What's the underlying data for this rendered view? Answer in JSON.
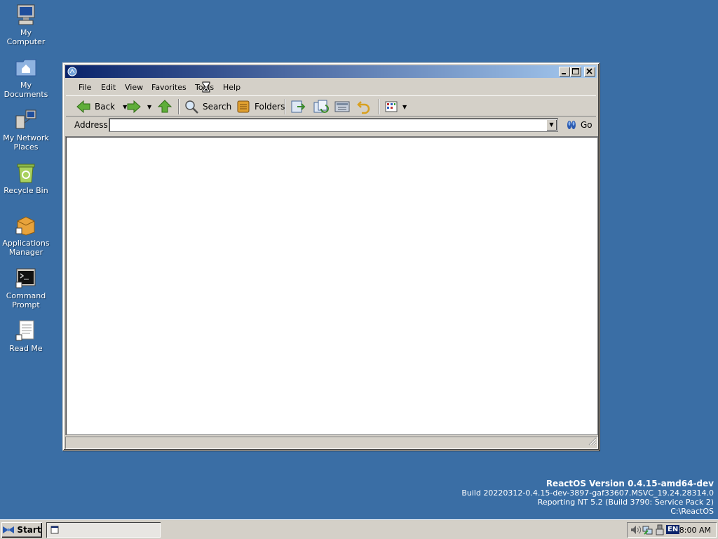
{
  "desktop": {
    "icons": [
      {
        "label": "My Computer"
      },
      {
        "label": "My Documents"
      },
      {
        "label": "My Network Places"
      },
      {
        "label": "Recycle Bin"
      },
      {
        "label": "Applications Manager"
      },
      {
        "label": "Command Prompt"
      },
      {
        "label": "Read Me"
      }
    ]
  },
  "window": {
    "title": "",
    "menu": [
      "File",
      "Edit",
      "View",
      "Favorites",
      "Tools",
      "Help"
    ],
    "toolbar": {
      "back_label": "Back",
      "search_label": "Search",
      "folders_label": "Folders"
    },
    "address": {
      "label": "Address",
      "value": "",
      "go_label": "Go"
    }
  },
  "version_info": {
    "line1": "ReactOS Version 0.4.15-amd64-dev",
    "line2": "Build 20220312-0.4.15-dev-3897-gaf33607.MSVC_19.24.28314.0",
    "line3": "Reporting NT 5.2 (Build 3790: Service Pack 2)",
    "line4": "C:\\ReactOS"
  },
  "taskbar": {
    "start_label": "Start",
    "language": "EN",
    "clock": "8:00 AM"
  },
  "colors": {
    "desktop": "#3a6ea5",
    "titlebar_start": "#0a246a",
    "titlebar_end": "#a6caf0"
  }
}
